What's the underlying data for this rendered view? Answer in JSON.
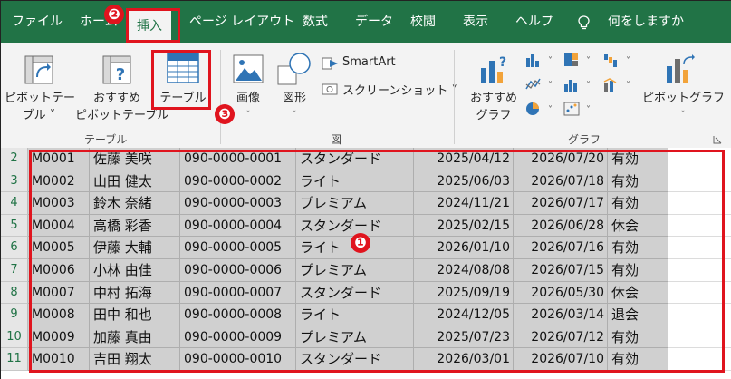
{
  "tabs": [
    {
      "label": "ファイル",
      "active": false
    },
    {
      "label": "ホーム",
      "active": false
    },
    {
      "label": "挿入",
      "active": true
    },
    {
      "label": "ページ レイアウト",
      "active": false
    },
    {
      "label": "数式",
      "active": false
    },
    {
      "label": "データ",
      "active": false
    },
    {
      "label": "校閲",
      "active": false
    },
    {
      "label": "表示",
      "active": false
    },
    {
      "label": "ヘルプ",
      "active": false
    },
    {
      "label": "何をしますか",
      "active": false
    }
  ],
  "ribbon": {
    "table_group": {
      "label": "テーブル",
      "pivot_table": {
        "line1": "ピボットテー",
        "line2": "ブル ˅"
      },
      "recommended_pivot": {
        "line1": "おすすめ",
        "line2": "ピボットテーブル"
      },
      "table": {
        "label": "テーブル"
      }
    },
    "illustrations_group": {
      "label": "図",
      "picture": {
        "label": "画像"
      },
      "shapes": {
        "label": "図形"
      },
      "smartart": {
        "label": "SmartArt"
      },
      "screenshot": {
        "label": "スクリーンショット ˅"
      }
    },
    "charts_group": {
      "label": "グラフ",
      "recommended_charts": {
        "line1": "おすすめ",
        "line2": "グラフ"
      },
      "pivot_chart": {
        "label": "ピボットグラフ"
      }
    }
  },
  "sheet": {
    "rows": [
      {
        "num": "2",
        "id": "M0001",
        "name": "佐藤 美咲",
        "tel": "090-0000-0001",
        "plan": "スタンダード",
        "start": "2025/04/12",
        "end": "2026/07/20",
        "status": "有効"
      },
      {
        "num": "3",
        "id": "M0002",
        "name": "山田 健太",
        "tel": "090-0000-0002",
        "plan": "ライト",
        "start": "2025/06/03",
        "end": "2026/07/18",
        "status": "有効"
      },
      {
        "num": "4",
        "id": "M0003",
        "name": "鈴木 奈緒",
        "tel": "090-0000-0003",
        "plan": "プレミアム",
        "start": "2024/11/21",
        "end": "2026/07/17",
        "status": "有効"
      },
      {
        "num": "5",
        "id": "M0004",
        "name": "高橋 彩香",
        "tel": "090-0000-0004",
        "plan": "スタンダード",
        "start": "2025/02/15",
        "end": "2026/06/28",
        "status": "休会"
      },
      {
        "num": "6",
        "id": "M0005",
        "name": "伊藤 大輔",
        "tel": "090-0000-0005",
        "plan": "ライト",
        "start": "2026/01/10",
        "end": "2026/07/16",
        "status": "有効"
      },
      {
        "num": "7",
        "id": "M0006",
        "name": "小林 由佳",
        "tel": "090-0000-0006",
        "plan": "プレミアム",
        "start": "2024/08/08",
        "end": "2026/07/15",
        "status": "有効"
      },
      {
        "num": "8",
        "id": "M0007",
        "name": "中村 拓海",
        "tel": "090-0000-0007",
        "plan": "スタンダード",
        "start": "2025/09/19",
        "end": "2026/05/30",
        "status": "休会"
      },
      {
        "num": "9",
        "id": "M0008",
        "name": "田中 和也",
        "tel": "090-0000-0008",
        "plan": "ライト",
        "start": "2024/12/05",
        "end": "2026/03/14",
        "status": "退会"
      },
      {
        "num": "10",
        "id": "M0009",
        "name": "加藤 真由",
        "tel": "090-0000-0009",
        "plan": "プレミアム",
        "start": "2025/07/23",
        "end": "2026/07/12",
        "status": "有効"
      },
      {
        "num": "11",
        "id": "M0010",
        "name": "吉田 翔太",
        "tel": "090-0000-0010",
        "plan": "スタンダード",
        "start": "2026/03/01",
        "end": "2026/07/10",
        "status": "有効"
      }
    ]
  },
  "annotations": {
    "step1": "❶",
    "step2": "❷",
    "step3": "❸",
    "highlight_color": "#e0141e"
  },
  "colors": {
    "tab_bar": "#217346",
    "ribbon": "#f3f3f3",
    "selection_fill": "#d0d0d0"
  }
}
